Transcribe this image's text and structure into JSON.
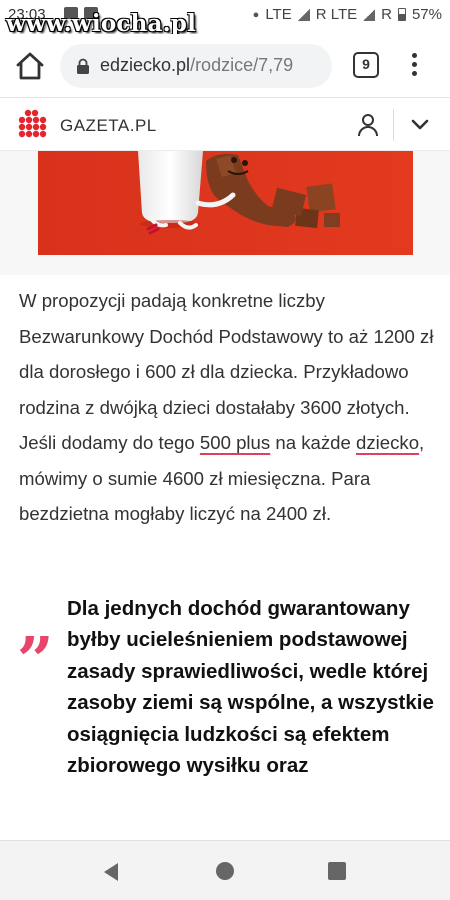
{
  "status_bar": {
    "time": "23:03",
    "watermark": "www.wiocha.pl",
    "network_1": "LTE",
    "network_2": "R LTE",
    "roaming": "R",
    "battery": "57%"
  },
  "browser": {
    "url_domain": "edziecko.pl",
    "url_path": "/rodzice/7,79",
    "tab_count": "9"
  },
  "site": {
    "logo_text": "GAZETA.PL",
    "accent_color": "#e4252e"
  },
  "article": {
    "p1": "W propozycji padają konkretne liczby Bezwarunkowy Dochód Podstawowy to aż 1200 zł dla dorosłego i 600 zł dla dziecka. Przykładowo rodzina z dwójką dzieci dostałaby 3600 złotych. Jeśli dodamy do tego ",
    "link1": "500 plus",
    "p2": " na każde ",
    "link2": "dziecko",
    "p3": ", mówimy o sumie 4600 zł miesięczna. Para bezdzietna mogłaby liczyć na 2400 zł.",
    "quote_mark": "„",
    "quote": "Dla jednych dochód gwarantowany byłby ucieleśnieniem podstawowej zasady sprawiedliwości, wedle której zasoby ziemi są wspólne, a wszystkie osiągnięcia ludzkości są efektem zbiorowego wysiłku oraz"
  },
  "icons": {
    "home": "home-icon",
    "lock": "lock-icon",
    "menu": "more-vert-icon",
    "user": "user-icon",
    "chevron": "chevron-down-icon",
    "nav_back": "back-triangle-icon",
    "nav_home": "home-circle-icon",
    "nav_recent": "recent-square-icon"
  }
}
